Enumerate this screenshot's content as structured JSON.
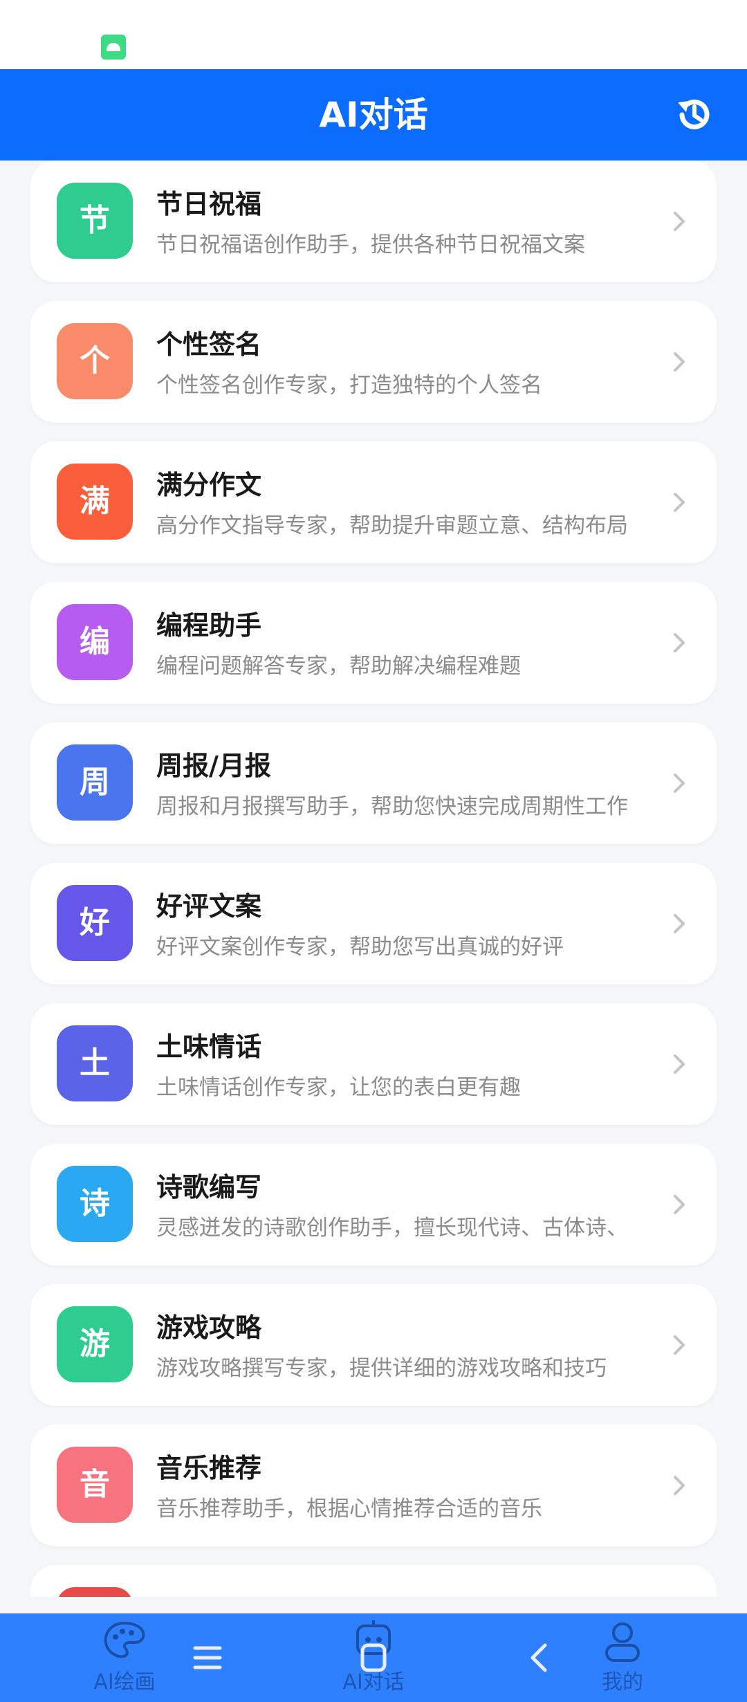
{
  "status_bar": {
    "notification_icon": "android-icon"
  },
  "app_bar": {
    "title": "AI对话",
    "action_icon": "history-icon"
  },
  "accent_color": "#0b6cff",
  "items": [
    {
      "badge": "节",
      "name": "节日祝福",
      "desc": "节日祝福语创作助手，提供各种节日祝福文案",
      "color": "#2ecc8f"
    },
    {
      "badge": "个",
      "name": "个性签名",
      "desc": "个性签名创作专家，打造独特的个人签名",
      "color": "#f98a6a"
    },
    {
      "badge": "满",
      "name": "满分作文",
      "desc": "高分作文指导专家，帮助提升审题立意、结构布局",
      "color": "#fa5e3b"
    },
    {
      "badge": "编",
      "name": "编程助手",
      "desc": "编程问题解答专家，帮助解决编程难题",
      "color": "#b65cf0"
    },
    {
      "badge": "周",
      "name": "周报/月报",
      "desc": "周报和月报撰写助手，帮助您快速完成周期性工作",
      "color": "#4b74ef"
    },
    {
      "badge": "好",
      "name": "好评文案",
      "desc": "好评文案创作专家，帮助您写出真诚的好评",
      "color": "#6557ea"
    },
    {
      "badge": "土",
      "name": "土味情话",
      "desc": "土味情话创作专家，让您的表白更有趣",
      "color": "#5b63e8"
    },
    {
      "badge": "诗",
      "name": "诗歌编写",
      "desc": "灵感迸发的诗歌创作助手，擅长现代诗、古体诗、",
      "color": "#2aa8f2"
    },
    {
      "badge": "游",
      "name": "游戏攻略",
      "desc": "游戏攻略撰写专家，提供详细的游戏攻略和技巧",
      "color": "#2ecc8f"
    },
    {
      "badge": "音",
      "name": "音乐推荐",
      "desc": "音乐推荐助手，根据心情推荐合适的音乐",
      "color": "#f7737e"
    },
    {
      "badge": "",
      "name": "",
      "desc": "",
      "color": "#e84a4a"
    }
  ],
  "tabs": [
    {
      "label": "AI绘画",
      "icon": "palette-icon"
    },
    {
      "label": "AI对话",
      "icon": "robot-icon"
    },
    {
      "label": "我的",
      "icon": "user-icon"
    }
  ],
  "system_nav": [
    "menu-icon",
    "home-icon",
    "back-icon"
  ]
}
